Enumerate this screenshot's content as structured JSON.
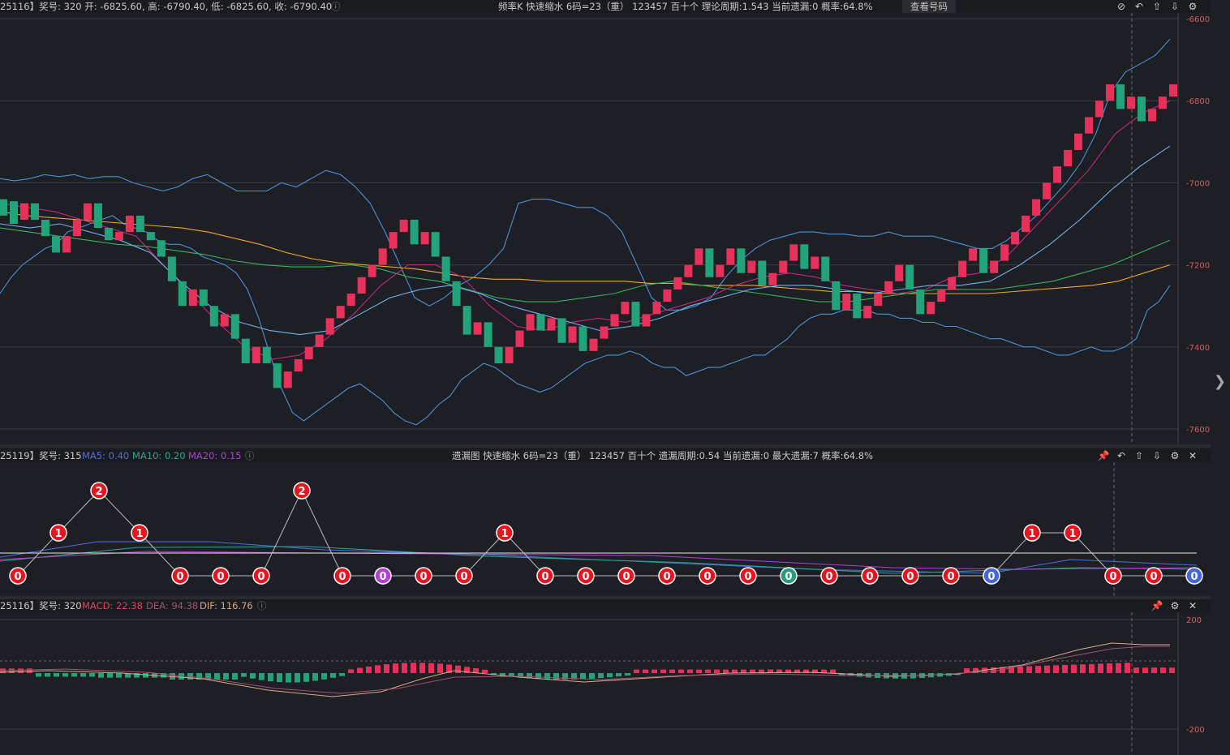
{
  "panel1": {
    "info": "25116】奖号: 320  开: -6825.60, 高: -6790.40, 低: -6825.60, 收: -6790.40",
    "title": "频率K  快速缩水  6码=23（重）  123457  百十个  理论周期:1.543  当前遗漏:0  概率:64.8%",
    "view_button": "查看号码",
    "y_ticks": [
      "-6600",
      "-6800",
      "-7000",
      "-7200",
      "-7400",
      "-7600"
    ]
  },
  "panel2": {
    "info_prefix": "25119】奖号: 315",
    "ma5": "MA5: 0.40",
    "ma10": "MA10: 0.20",
    "ma20": "MA20: 0.15",
    "title": "遗漏图  快速缩水  6码=23（重）  123457  百十个  遗漏周期:0.54  当前遗漏:0  最大遗漏:7  概率:64.8%",
    "values": [
      0,
      1,
      2,
      1,
      0,
      0,
      0,
      2,
      0,
      0,
      0,
      0,
      1,
      0,
      0,
      0,
      0,
      0,
      0,
      0,
      0,
      0,
      0,
      0,
      0,
      1,
      1,
      0,
      0,
      0
    ],
    "colors": [
      "#e8141e",
      "#e8141e",
      "#e8141e",
      "#e8141e",
      "#e8141e",
      "#e8141e",
      "#e8141e",
      "#e8141e",
      "#e8141e",
      "#b43dd6",
      "#e8141e",
      "#e8141e",
      "#e8141e",
      "#e8141e",
      "#e8141e",
      "#e8141e",
      "#e8141e",
      "#e8141e",
      "#e8141e",
      "#2a9a78",
      "#e8141e",
      "#e8141e",
      "#e8141e",
      "#e8141e",
      "#4466dd",
      "#e8141e",
      "#e8141e",
      "#e8141e",
      "#e8141e",
      "#4466dd"
    ]
  },
  "panel3": {
    "info_prefix": "25116】奖号: 320",
    "macd": "MACD: 22.38",
    "dea": "DEA: 94.38",
    "dif": "DIF: 116.76",
    "y_ticks": [
      "200",
      "-200"
    ]
  },
  "chart_data": {
    "type": "candlestick",
    "ylim": [
      -7600,
      -6600
    ],
    "y_ticks": [
      -6600,
      -6800,
      -7000,
      -7200,
      -7400,
      -7600
    ],
    "candles": [
      {
        "o": -7040,
        "c": -7080,
        "up": false
      },
      {
        "o": -7045,
        "c": -7100,
        "up": false
      },
      {
        "o": -7090,
        "c": -7050,
        "up": true
      },
      {
        "o": -7050,
        "c": -7090,
        "up": false
      },
      {
        "o": -7090,
        "c": -7130,
        "up": false
      },
      {
        "o": -7130,
        "c": -7170,
        "up": false
      },
      {
        "o": -7170,
        "c": -7130,
        "up": true
      },
      {
        "o": -7130,
        "c": -7090,
        "up": true
      },
      {
        "o": -7090,
        "c": -7050,
        "up": true
      },
      {
        "o": -7050,
        "c": -7110,
        "up": false
      },
      {
        "o": -7110,
        "c": -7140,
        "up": false
      },
      {
        "o": -7140,
        "c": -7120,
        "up": true
      },
      {
        "o": -7120,
        "c": -7080,
        "up": true
      },
      {
        "o": -7080,
        "c": -7120,
        "up": false
      },
      {
        "o": -7120,
        "c": -7140,
        "up": false
      },
      {
        "o": -7140,
        "c": -7180,
        "up": false
      },
      {
        "o": -7180,
        "c": -7240,
        "up": false
      },
      {
        "o": -7240,
        "c": -7300,
        "up": false
      },
      {
        "o": -7300,
        "c": -7260,
        "up": true
      },
      {
        "o": -7260,
        "c": -7300,
        "up": false
      },
      {
        "o": -7300,
        "c": -7350,
        "up": false
      },
      {
        "o": -7350,
        "c": -7320,
        "up": true
      },
      {
        "o": -7320,
        "c": -7380,
        "up": false
      },
      {
        "o": -7380,
        "c": -7440,
        "up": false
      },
      {
        "o": -7440,
        "c": -7400,
        "up": true
      },
      {
        "o": -7400,
        "c": -7440,
        "up": false
      },
      {
        "o": -7440,
        "c": -7500,
        "up": false
      },
      {
        "o": -7500,
        "c": -7460,
        "up": true
      },
      {
        "o": -7460,
        "c": -7430,
        "up": true
      },
      {
        "o": -7430,
        "c": -7400,
        "up": true
      },
      {
        "o": -7400,
        "c": -7370,
        "up": true
      },
      {
        "o": -7370,
        "c": -7330,
        "up": true
      },
      {
        "o": -7330,
        "c": -7300,
        "up": true
      },
      {
        "o": -7300,
        "c": -7270,
        "up": true
      },
      {
        "o": -7270,
        "c": -7230,
        "up": true
      },
      {
        "o": -7230,
        "c": -7200,
        "up": true
      },
      {
        "o": -7200,
        "c": -7160,
        "up": true
      },
      {
        "o": -7160,
        "c": -7120,
        "up": true
      },
      {
        "o": -7120,
        "c": -7090,
        "up": true
      },
      {
        "o": -7090,
        "c": -7150,
        "up": false
      },
      {
        "o": -7150,
        "c": -7120,
        "up": true
      },
      {
        "o": -7120,
        "c": -7180,
        "up": false
      },
      {
        "o": -7180,
        "c": -7240,
        "up": false
      },
      {
        "o": -7240,
        "c": -7300,
        "up": false
      },
      {
        "o": -7300,
        "c": -7370,
        "up": false
      },
      {
        "o": -7370,
        "c": -7340,
        "up": true
      },
      {
        "o": -7340,
        "c": -7400,
        "up": false
      },
      {
        "o": -7400,
        "c": -7440,
        "up": false
      },
      {
        "o": -7440,
        "c": -7400,
        "up": true
      },
      {
        "o": -7400,
        "c": -7360,
        "up": true
      },
      {
        "o": -7360,
        "c": -7320,
        "up": true
      },
      {
        "o": -7320,
        "c": -7360,
        "up": false
      },
      {
        "o": -7360,
        "c": -7330,
        "up": true
      },
      {
        "o": -7330,
        "c": -7390,
        "up": false
      },
      {
        "o": -7390,
        "c": -7350,
        "up": true
      },
      {
        "o": -7350,
        "c": -7410,
        "up": false
      },
      {
        "o": -7410,
        "c": -7380,
        "up": true
      },
      {
        "o": -7380,
        "c": -7350,
        "up": true
      },
      {
        "o": -7350,
        "c": -7320,
        "up": true
      },
      {
        "o": -7320,
        "c": -7290,
        "up": true
      },
      {
        "o": -7290,
        "c": -7350,
        "up": false
      },
      {
        "o": -7350,
        "c": -7320,
        "up": true
      },
      {
        "o": -7320,
        "c": -7290,
        "up": true
      },
      {
        "o": -7290,
        "c": -7260,
        "up": true
      },
      {
        "o": -7260,
        "c": -7230,
        "up": true
      },
      {
        "o": -7230,
        "c": -7200,
        "up": true
      },
      {
        "o": -7200,
        "c": -7160,
        "up": true
      },
      {
        "o": -7160,
        "c": -7230,
        "up": false
      },
      {
        "o": -7230,
        "c": -7200,
        "up": true
      },
      {
        "o": -7200,
        "c": -7160,
        "up": true
      },
      {
        "o": -7160,
        "c": -7220,
        "up": false
      },
      {
        "o": -7220,
        "c": -7190,
        "up": true
      },
      {
        "o": -7190,
        "c": -7250,
        "up": false
      },
      {
        "o": -7250,
        "c": -7220,
        "up": true
      },
      {
        "o": -7220,
        "c": -7190,
        "up": true
      },
      {
        "o": -7190,
        "c": -7150,
        "up": true
      },
      {
        "o": -7150,
        "c": -7210,
        "up": false
      },
      {
        "o": -7210,
        "c": -7180,
        "up": true
      },
      {
        "o": -7180,
        "c": -7240,
        "up": false
      },
      {
        "o": -7240,
        "c": -7310,
        "up": false
      },
      {
        "o": -7310,
        "c": -7270,
        "up": true
      },
      {
        "o": -7270,
        "c": -7330,
        "up": false
      },
      {
        "o": -7330,
        "c": -7300,
        "up": true
      },
      {
        "o": -7300,
        "c": -7270,
        "up": true
      },
      {
        "o": -7270,
        "c": -7240,
        "up": true
      },
      {
        "o": -7240,
        "c": -7200,
        "up": true
      },
      {
        "o": -7200,
        "c": -7260,
        "up": false
      },
      {
        "o": -7260,
        "c": -7320,
        "up": false
      },
      {
        "o": -7320,
        "c": -7290,
        "up": true
      },
      {
        "o": -7290,
        "c": -7260,
        "up": true
      },
      {
        "o": -7260,
        "c": -7230,
        "up": true
      },
      {
        "o": -7230,
        "c": -7190,
        "up": true
      },
      {
        "o": -7190,
        "c": -7160,
        "up": true
      },
      {
        "o": -7160,
        "c": -7220,
        "up": false
      },
      {
        "o": -7220,
        "c": -7190,
        "up": true
      },
      {
        "o": -7190,
        "c": -7150,
        "up": true
      },
      {
        "o": -7150,
        "c": -7120,
        "up": true
      },
      {
        "o": -7120,
        "c": -7080,
        "up": true
      },
      {
        "o": -7080,
        "c": -7040,
        "up": true
      },
      {
        "o": -7040,
        "c": -7000,
        "up": true
      },
      {
        "o": -7000,
        "c": -6960,
        "up": true
      },
      {
        "o": -6960,
        "c": -6920,
        "up": true
      },
      {
        "o": -6920,
        "c": -6880,
        "up": true
      },
      {
        "o": -6880,
        "c": -6840,
        "up": true
      },
      {
        "o": -6840,
        "c": -6800,
        "up": true
      },
      {
        "o": -6800,
        "c": -6760,
        "up": true
      },
      {
        "o": -6760,
        "c": -6820,
        "up": false
      },
      {
        "o": -6820,
        "c": -6790,
        "up": true
      },
      {
        "o": -6790,
        "c": -6850,
        "up": false
      },
      {
        "o": -6850,
        "c": -6820,
        "up": true
      },
      {
        "o": -6820,
        "c": -6790,
        "up": true
      },
      {
        "o": -6790,
        "c": -6760,
        "up": true
      }
    ],
    "up_color": "#e8315a",
    "down_color": "#23a37a",
    "lines": [
      {
        "color": "#4a8fd8",
        "values": [
          -7270,
          -7230,
          -7200,
          -7180,
          -7160,
          -7150,
          -7120,
          -7110,
          -7100,
          -7090,
          -7080,
          -7100,
          -7110,
          -7120,
          -7140,
          -7150,
          -7150,
          -7160,
          -7180,
          -7190,
          -7200,
          -7220,
          -7260,
          -7330,
          -7420,
          -7500,
          -7560,
          -7580,
          -7560,
          -7540,
          -7520,
          -7500,
          -7490,
          -7510,
          -7530,
          -7560,
          -7580,
          -7590,
          -7570,
          -7540,
          -7520,
          -7480,
          -7460,
          -7440,
          -7450,
          -7470,
          -7490,
          -7500,
          -7510,
          -7500,
          -7480,
          -7460,
          -7440,
          -7430,
          -7420,
          -7420,
          -7410,
          -7420,
          -7440,
          -7450,
          -7450,
          -7470,
          -7460,
          -7450,
          -7450,
          -7440,
          -7430,
          -7420,
          -7420,
          -7400,
          -7380,
          -7350,
          -7330,
          -7320,
          -7320,
          -7310,
          -7310,
          -7310,
          -7320,
          -7320,
          -7330,
          -7330,
          -7340,
          -7340,
          -7350,
          -7350,
          -7360,
          -7370,
          -7380,
          -7380,
          -7390,
          -7400,
          -7400,
          -7410,
          -7420,
          -7420,
          -7410,
          -7400,
          -7410,
          -7410,
          -7400,
          -7380,
          -7310,
          -7290,
          -7250
        ]
      },
      {
        "color": "#4a8fd8",
        "values": [
          -6990,
          -6995,
          -6990,
          -6980,
          -6985,
          -6980,
          -6990,
          -6985,
          -6985,
          -7000,
          -7010,
          -7020,
          -7010,
          -6990,
          -6980,
          -7000,
          -7020,
          -7020,
          -7020,
          -7000,
          -7010,
          -6990,
          -6970,
          -6980,
          -7010,
          -7050,
          -7120,
          -7200,
          -7280,
          -7300,
          -7280,
          -7250,
          -7230,
          -7200,
          -7160,
          -7050,
          -7040,
          -7040,
          -7050,
          -7060,
          -7060,
          -7080,
          -7120,
          -7200,
          -7280,
          -7310,
          -7310,
          -7300,
          -7280,
          -7230,
          -7190,
          -7160,
          -7140,
          -7130,
          -7120,
          -7120,
          -7125,
          -7125,
          -7130,
          -7130,
          -7120,
          -7130,
          -7130,
          -7130,
          -7140,
          -7150,
          -7160,
          -7160,
          -7140,
          -7110,
          -7080,
          -7040,
          -7000,
          -6950,
          -6880,
          -6780,
          -6730,
          -6710,
          -6690,
          -6650
        ]
      },
      {
        "color": "#f0a52a",
        "values": [
          -7070,
          -7080,
          -7085,
          -7090,
          -7095,
          -7100,
          -7105,
          -7110,
          -7120,
          -7135,
          -7150,
          -7170,
          -7185,
          -7195,
          -7200,
          -7205,
          -7210,
          -7220,
          -7230,
          -7235,
          -7235,
          -7240,
          -7240,
          -7240,
          -7240,
          -7245,
          -7245,
          -7250,
          -7250,
          -7250,
          -7255,
          -7260,
          -7265,
          -7265,
          -7270,
          -7270,
          -7270,
          -7270,
          -7270,
          -7265,
          -7260,
          -7255,
          -7250,
          -7240,
          -7220,
          -7200
        ]
      },
      {
        "color": "#35b35b",
        "values": [
          -7110,
          -7120,
          -7130,
          -7140,
          -7150,
          -7155,
          -7165,
          -7175,
          -7190,
          -7200,
          -7205,
          -7205,
          -7200,
          -7210,
          -7230,
          -7240,
          -7260,
          -7280,
          -7290,
          -7290,
          -7280,
          -7270,
          -7250,
          -7240,
          -7250,
          -7260,
          -7270,
          -7280,
          -7290,
          -7290,
          -7280,
          -7270,
          -7260,
          -7260,
          -7260,
          -7250,
          -7240,
          -7220,
          -7200,
          -7170,
          -7140
        ]
      },
      {
        "color": "#c2287d",
        "values": [
          -7050,
          -7060,
          -7070,
          -7090,
          -7110,
          -7130,
          -7200,
          -7270,
          -7340,
          -7400,
          -7430,
          -7420,
          -7380,
          -7320,
          -7250,
          -7200,
          -7200,
          -7230,
          -7300,
          -7350,
          -7360,
          -7340,
          -7330,
          -7340,
          -7320,
          -7300,
          -7280,
          -7250,
          -7230,
          -7220,
          -7230,
          -7250,
          -7260,
          -7270,
          -7260,
          -7230,
          -7220,
          -7180,
          -7110,
          -7040,
          -6970,
          -6880,
          -6830,
          -6800
        ]
      },
      {
        "color": "#6fb0f0",
        "values": [
          -7100,
          -7110,
          -7100,
          -7120,
          -7140,
          -7170,
          -7240,
          -7300,
          -7340,
          -7360,
          -7370,
          -7360,
          -7320,
          -7280,
          -7260,
          -7250,
          -7270,
          -7300,
          -7320,
          -7340,
          -7360,
          -7350,
          -7330,
          -7300,
          -7280,
          -7260,
          -7250,
          -7250,
          -7260,
          -7270,
          -7260,
          -7250,
          -7250,
          -7240,
          -7200,
          -7150,
          -7090,
          -7020,
          -6960,
          -6910
        ]
      }
    ]
  }
}
